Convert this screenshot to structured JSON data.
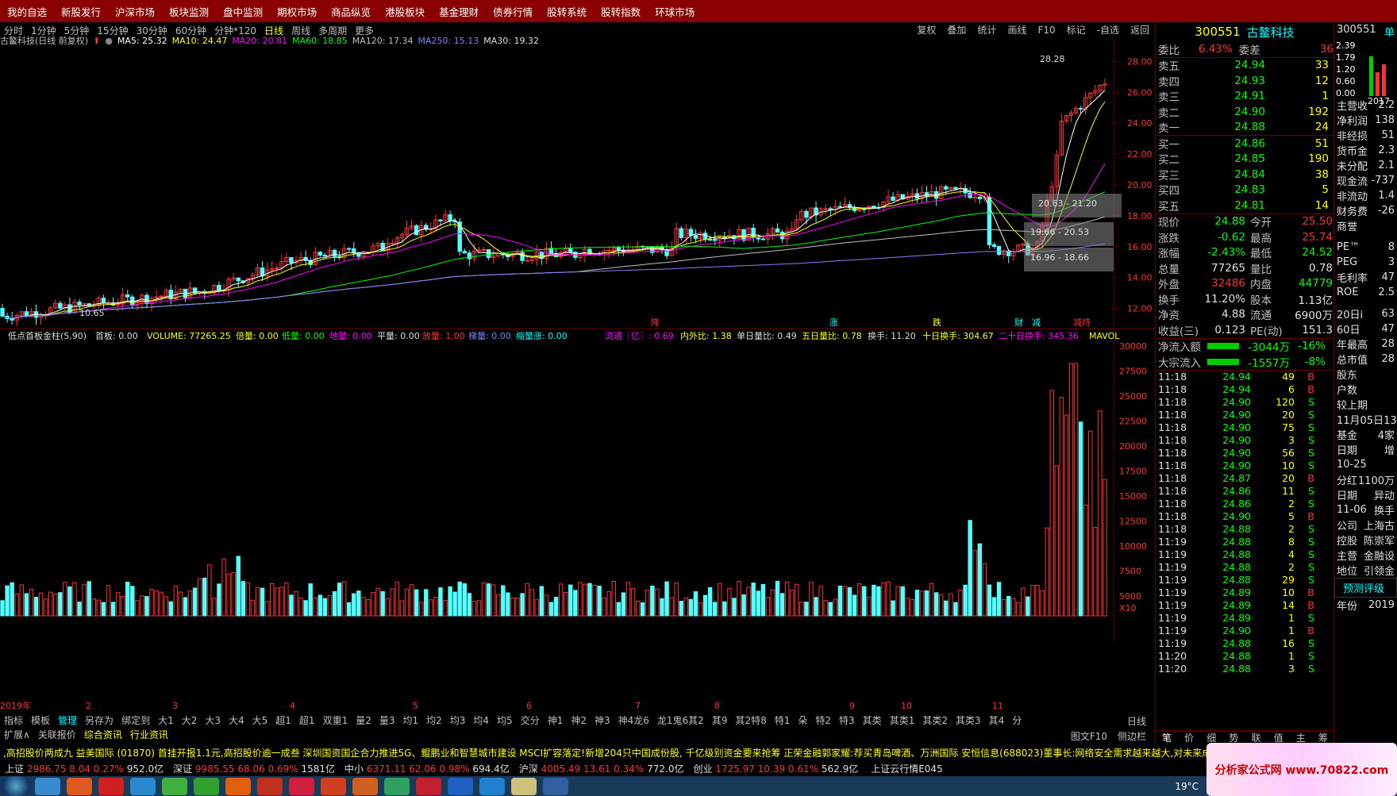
{
  "topnav": [
    "我的自选",
    "新股发行",
    "沪深市场",
    "板块监测",
    "盘中监测",
    "期权市场",
    "商品纵览",
    "港股板块",
    "基金理财",
    "债券行情",
    "股转系统",
    "股转指数",
    "环球市场"
  ],
  "periods": [
    "分时",
    "1分钟",
    "5分钟",
    "15分钟",
    "30分钟",
    "60分钟",
    "分钟*120",
    "日线",
    "周线",
    "多周期",
    "更多"
  ],
  "active_period": "日线",
  "toolbar_right": [
    "复权",
    "叠加",
    "统计",
    "画线",
    "F10",
    "标记",
    "-自选",
    "返回"
  ],
  "ma_line": {
    "name": "古鳌科技(日线 前复权)",
    "ma5": "MA5: 25.32",
    "ma10": "MA10: 24.47",
    "ma20": "MA20: 20.81",
    "ma60": "MA60: 18.85",
    "ma120": "MA120: 17.34",
    "ma250": "MA250: 15.13",
    "ma30": "MA30: 19.32"
  },
  "price_axis": [
    "28.00",
    "26.00",
    "24.00",
    "22.00",
    "20.00",
    "18.00",
    "16.00",
    "14.00",
    "12.00"
  ],
  "chart_labels": {
    "high": "28.28",
    "low": "10.65",
    "box1": "20.63 - 21.20",
    "box2": "19.66 - 20.53",
    "box3": "16.96 - 18.66"
  },
  "vol_header": {
    "ind": "低点首板金柱(5,90)",
    "shouban": "首板: 0.00",
    "volume": "VOLUME: 77265.25",
    "beiliang": "倍量: 0.00",
    "diliang": "低量: 0.00",
    "diliang2": "地量: 0.00",
    "pingliang": "平量: 0.00",
    "fangliang": "放量: 1.00",
    "jiliang": "梯量: 0.00",
    "suoliang": "缩量涨: 0.00",
    "liutong": "流通〖亿〗: 0.69",
    "neiwai": "内外比: 1.38",
    "danri": "单日量比: 0.49",
    "wuri": "五日量比: 0.78",
    "huanshou": "换手: 11.20",
    "shiri": "十日换手: 304.67",
    "ershi": "二十日换手: 345.36",
    "mavol": "MAVOL"
  },
  "vol_axis": [
    "30000",
    "27500",
    "25000",
    "22500",
    "20000",
    "17500",
    "15000",
    "12500",
    "10000",
    "7500",
    "5000",
    "X10"
  ],
  "months": [
    "2019年",
    "2",
    "3",
    "4",
    "5",
    "6",
    "7",
    "8",
    "9",
    "10",
    "11"
  ],
  "stock": {
    "code": "300551",
    "name": "古鳌科技"
  },
  "weibi": {
    "l1": "委比",
    "v1": "6.43%",
    "l2": "委差",
    "v2": "36"
  },
  "asks": [
    {
      "l": "卖五",
      "p": "24.94",
      "v": "33"
    },
    {
      "l": "卖四",
      "p": "24.93",
      "v": "12"
    },
    {
      "l": "卖三",
      "p": "24.91",
      "v": "1"
    },
    {
      "l": "卖二",
      "p": "24.90",
      "v": "192"
    },
    {
      "l": "卖一",
      "p": "24.88",
      "v": "24"
    }
  ],
  "bids": [
    {
      "l": "买一",
      "p": "24.86",
      "v": "51"
    },
    {
      "l": "买二",
      "p": "24.85",
      "v": "190"
    },
    {
      "l": "买三",
      "p": "24.84",
      "v": "38"
    },
    {
      "l": "买四",
      "p": "24.83",
      "v": "5"
    },
    {
      "l": "买五",
      "p": "24.81",
      "v": "14"
    }
  ],
  "quote": [
    {
      "a": "现价",
      "av": "24.88",
      "b": "今开",
      "bv": "25.50"
    },
    {
      "a": "涨跌",
      "av": "-0.62",
      "b": "最高",
      "bv": "25.74"
    },
    {
      "a": "涨幅",
      "av": "-2.43%",
      "b": "最低",
      "bv": "24.52"
    },
    {
      "a": "总量",
      "av": "77265",
      "b": "量比",
      "bv": "0.78"
    },
    {
      "a": "外盘",
      "av": "32486",
      "b": "内盘",
      "bv": "44779"
    },
    {
      "a": "换手",
      "av": "11.20%",
      "b": "股本",
      "bv": "1.13亿"
    },
    {
      "a": "净资",
      "av": "4.88",
      "b": "流通",
      "bv": "6900万"
    },
    {
      "a": "收益(三)",
      "av": "0.123",
      "b": "PE(动)",
      "bv": "151.3"
    }
  ],
  "flow": [
    {
      "l": "净流入额",
      "v": "-3044万",
      "p": "-16%"
    },
    {
      "l": "大宗流入",
      "v": "-1557万",
      "p": "-8%"
    }
  ],
  "ticks": [
    [
      "11:18",
      "24.94",
      "49",
      "B"
    ],
    [
      "11:18",
      "24.94",
      "6",
      "B"
    ],
    [
      "11:18",
      "24.90",
      "120",
      "S"
    ],
    [
      "11:18",
      "24.90",
      "20",
      "S"
    ],
    [
      "11:18",
      "24.90",
      "75",
      "S"
    ],
    [
      "11:18",
      "24.90",
      "3",
      "S"
    ],
    [
      "11:18",
      "24.90",
      "56",
      "S"
    ],
    [
      "11:18",
      "24.90",
      "10",
      "S"
    ],
    [
      "11:18",
      "24.87",
      "20",
      "B"
    ],
    [
      "11:18",
      "24.86",
      "11",
      "S"
    ],
    [
      "11:18",
      "24.86",
      "2",
      "S"
    ],
    [
      "11:18",
      "24.90",
      "5",
      "B"
    ],
    [
      "11:18",
      "24.88",
      "2",
      "S"
    ],
    [
      "11:19",
      "24.88",
      "8",
      "S"
    ],
    [
      "11:19",
      "24.88",
      "4",
      "S"
    ],
    [
      "11:19",
      "24.88",
      "2",
      "S"
    ],
    [
      "11:19",
      "24.88",
      "29",
      "S"
    ],
    [
      "11:19",
      "24.89",
      "10",
      "B"
    ],
    [
      "11:19",
      "24.89",
      "14",
      "B"
    ],
    [
      "11:19",
      "24.89",
      "1",
      "S"
    ],
    [
      "11:19",
      "24.90",
      "1",
      "B"
    ],
    [
      "11:19",
      "24.88",
      "16",
      "S"
    ],
    [
      "11:20",
      "24.88",
      "1",
      "S"
    ],
    [
      "11:20",
      "24.88",
      "3",
      "S"
    ]
  ],
  "rtabs": [
    "笔",
    "价",
    "细",
    "势",
    "联",
    "值",
    "主",
    "筹"
  ],
  "farright": {
    "code": "300551",
    "tag": "单",
    "fin": [
      "主营收",
      "净利润",
      "非经损",
      "货币金",
      "未分配",
      "现金流",
      "非流动",
      "财务费",
      "商誉"
    ],
    "finv": [
      "2.2",
      "138",
      "51",
      "2.3",
      "2.1",
      "-737",
      "1.4",
      "-26",
      ""
    ],
    "pe": [
      "PE™",
      "PEG",
      "毛利率",
      "ROE"
    ],
    "pev": [
      "8",
      "3",
      "47",
      "2.5"
    ],
    "stat": [
      "20日i",
      "60日",
      "年最高",
      "总市值"
    ],
    "statv": [
      "63",
      "47",
      "28",
      "28"
    ],
    "other": [
      "股东",
      "户数",
      "较上期"
    ],
    "date": "11月05日13",
    "fund": "基金",
    "fundv": "4家",
    "rq": "日期",
    "rqv": "增",
    "d1": "10-25",
    "fh": "分红",
    "fhv": "1100万",
    "rq2": "日期",
    "rq2v": "异动",
    "d2": "11-06",
    "d2v": "换手",
    "co": [
      "公司",
      "控股",
      "主营",
      "地位"
    ],
    "cov": [
      "上海古",
      "陈崇军",
      "金融设",
      "引领金"
    ],
    "rating": "预测评级",
    "year": "年份",
    "yearv": "2019",
    "ylabels": [
      "2.39",
      "1.79",
      "1.20",
      "0.60",
      "0.00"
    ],
    "yr": "2017"
  },
  "bottom1": [
    "指标",
    "模板",
    "管理",
    "另存为",
    "绑定到",
    "大1",
    "大2",
    "大3",
    "大4",
    "大5",
    "超1",
    "超1",
    "双重1",
    "量2",
    "量3",
    "均1",
    "均2",
    "均3",
    "均4",
    "均5",
    "交分",
    "神1",
    "神2",
    "神3",
    "神4龙6",
    "龙1鬼6其2",
    "其9",
    "其2特8",
    "特1",
    "朵",
    "特2",
    "特3",
    "其类",
    "其类1",
    "其类2",
    "其类3",
    "其4",
    "分"
  ],
  "bottom2": [
    "扩展∧",
    "关联报价",
    "综合资讯",
    "行业资讯"
  ],
  "rside": [
    "日线",
    "图文F10",
    "侧边栏"
  ],
  "ticker": ",高招股价两成九     益美国际 (01870) 首挂开报1.1元,高招股价逾一成叁     深圳国资国企合力推进5G、鲲鹏业和智慧城市建设     MSCI扩容落定!新增204只中国成份股, 千亿级别资金要来抢筹     正荣金融郭家耀:荐买青岛啤酒、万洲国际     安恒信息(688023)董事长:网络安全需求越来越大,对未来成长充满",
  "indices": [
    {
      "n": "上证",
      "v": "2986.75",
      "c": "8.04",
      "p": "0.27%",
      "a": "952.0亿"
    },
    {
      "n": "深证",
      "v": "9985.55",
      "c": "68.06",
      "p": "0.69%",
      "a": "1581亿"
    },
    {
      "n": "中小",
      "v": "6371.11",
      "c": "62.06",
      "p": "0.98%",
      "a": "694.4亿"
    },
    {
      "n": "沪深",
      "v": "4005.49",
      "c": "13.61",
      "p": "0.34%",
      "a": "772.0亿"
    },
    {
      "n": "创业",
      "v": "1725.97",
      "c": "10.39",
      "p": "0.61%",
      "a": "562.9亿"
    }
  ],
  "cloud": "上证云行情E045",
  "watermark": "分析家公式网 www.70822.com",
  "weather": "19°C",
  "markers": [
    "降",
    "涨",
    "跌",
    "财",
    "减",
    "减持"
  ],
  "colors": {
    "up": "#ff3030",
    "down": "#54ffff",
    "ma5": "#ffffff",
    "ma10": "#ffff00",
    "ma20": "#ff00ff",
    "ma60": "#00ff00",
    "ma120": "#c0c0c0",
    "ma250": "#8080ff"
  }
}
